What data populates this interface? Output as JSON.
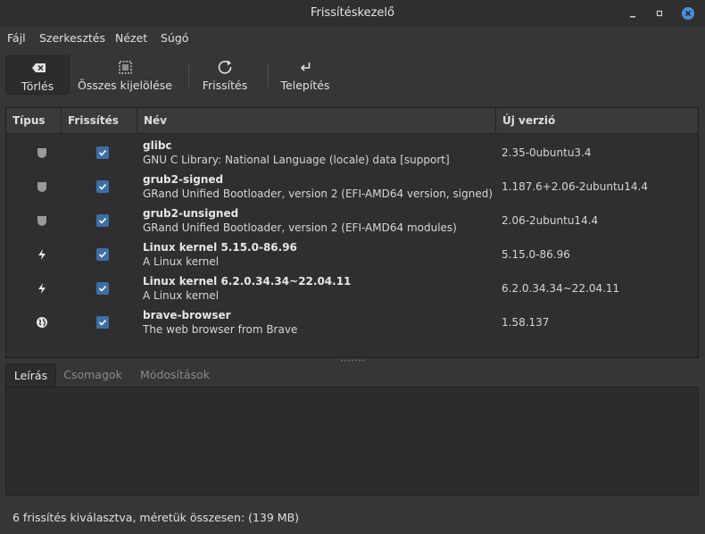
{
  "window": {
    "title": "Frissítéskezelő"
  },
  "menu": [
    "Fájl",
    "Szerkesztés",
    "Nézet",
    "Súgó"
  ],
  "toolbar": {
    "clear_label": "Törlés",
    "select_all_label": "Összes kijelölése",
    "refresh_label": "Frissítés",
    "install_label": "Telepítés"
  },
  "columns": {
    "type": "Típus",
    "update": "Frissítés",
    "name": "Név",
    "new_version": "Új verzió"
  },
  "updates": [
    {
      "type_icon": "shield-icon",
      "checked": true,
      "name": "glibc",
      "description": "GNU C Library: National Language (locale) data [support]",
      "version": "2.35-0ubuntu3.4"
    },
    {
      "type_icon": "shield-icon",
      "checked": true,
      "name": "grub2-signed",
      "description": "GRand Unified Bootloader, version 2 (EFI-AMD64 version, signed)",
      "version": "1.187.6+2.06-2ubuntu14.4"
    },
    {
      "type_icon": "shield-icon",
      "checked": true,
      "name": "grub2-unsigned",
      "description": "GRand Unified Bootloader, version 2 (EFI-AMD64 modules)",
      "version": "2.06-2ubuntu14.4"
    },
    {
      "type_icon": "lightning-icon",
      "checked": true,
      "name": "Linux kernel 5.15.0-86.96",
      "description": "A Linux kernel",
      "version": "5.15.0-86.96"
    },
    {
      "type_icon": "lightning-icon",
      "checked": true,
      "name": "Linux kernel 6.2.0.34.34~22.04.11",
      "description": "A Linux kernel",
      "version": "6.2.0.34.34~22.04.11"
    },
    {
      "type_icon": "globe-icon",
      "checked": true,
      "name": "brave-browser",
      "description": "The web browser from Brave",
      "version": "1.58.137"
    }
  ],
  "tabs": [
    "Leírás",
    "Csomagok",
    "Módosítások"
  ],
  "active_tab": "Leírás",
  "status": "6 frissítés kiválasztva, méretük összesen: (139 MB)",
  "colors": {
    "accent": "#3c6fa6",
    "close_button": "#4a90d9"
  }
}
